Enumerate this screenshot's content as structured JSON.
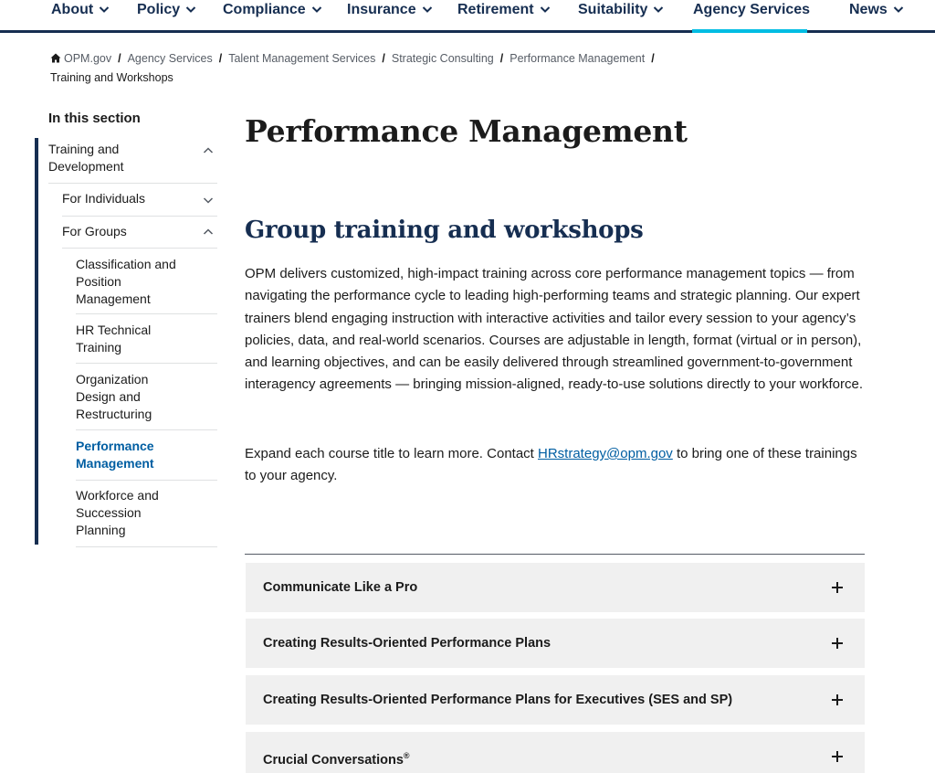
{
  "topnav": {
    "items": [
      {
        "label": "About"
      },
      {
        "label": "Policy"
      },
      {
        "label": "Compliance"
      },
      {
        "label": "Insurance"
      },
      {
        "label": "Retirement"
      },
      {
        "label": "Suitability"
      },
      {
        "label": "Agency Services",
        "active": true
      },
      {
        "label": "News"
      }
    ],
    "colors": {
      "text": "#162e51",
      "active_underline": "#00bde3"
    }
  },
  "breadcrumb": {
    "items": [
      "OPM.gov",
      "Agency Services",
      "Talent Management Services",
      "Strategic Consulting",
      "Performance Management"
    ],
    "current": "Training and Workshops",
    "separator": "/",
    "home_icon": "home-icon"
  },
  "sidenav": {
    "heading": "In this section",
    "items": [
      {
        "label": "Training and Development",
        "expanded": true
      },
      {
        "label": "For Individuals",
        "expanded": false
      },
      {
        "label": "For Groups",
        "expanded": true
      },
      {
        "label": "Classification and Position Management"
      },
      {
        "label": "HR Technical Training"
      },
      {
        "label": "Organization Design and Restructuring"
      },
      {
        "label": "Performance Management",
        "current": true
      },
      {
        "label": "Workforce and Succession Planning"
      }
    ]
  },
  "main": {
    "page_title": "Performance Management",
    "section_title": "Group training and workshops",
    "intro": "OPM delivers customized, high-impact training across core performance management topics — from navigating the performance cycle to leading high-performing teams and strategic planning. Our expert trainers blend engaging instruction with interactive activities and tailor every session to your agency’s policies, data, and real-world scenarios. Courses are adjustable in length, format (virtual or in person), and learning objectives, and can be easily delivered through streamlined government-to-government interagency agreements — bringing mission-aligned, ready-to-use solutions directly to your workforce.",
    "contact_before": "Expand each course title to learn more. Contact ",
    "contact_email": "HRstrategy@opm.gov",
    "contact_after": " to bring one of these trainings to your agency.",
    "accordion": [
      {
        "title": "Communicate Like a Pro"
      },
      {
        "title": "Creating Results-Oriented Performance Plans"
      },
      {
        "title": "Creating Results-Oriented Performance Plans for Executives (SES and SP)"
      },
      {
        "title": "Crucial Conversations",
        "sup": "®"
      }
    ],
    "accordion_icon": "plus-icon",
    "colors": {
      "link": "#005ea2",
      "heading": "#162e51",
      "accordion_bg": "#f0f0f0"
    }
  }
}
